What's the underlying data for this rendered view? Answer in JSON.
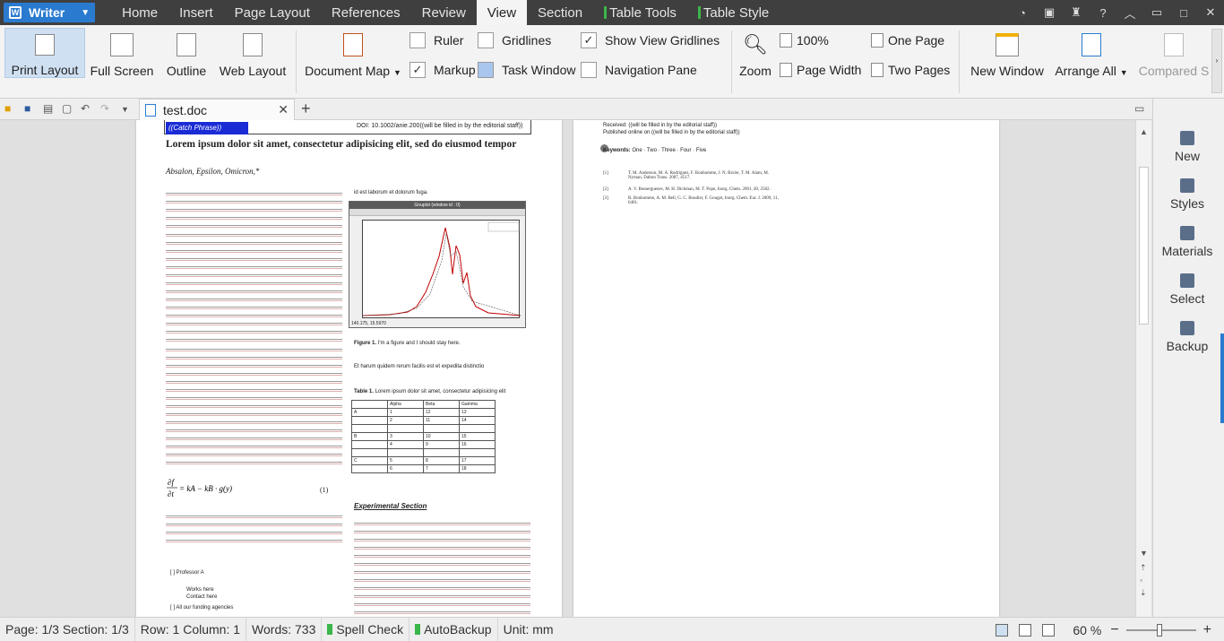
{
  "app": {
    "name": "Writer"
  },
  "menu": {
    "tabs": [
      {
        "label": "Home"
      },
      {
        "label": "Insert"
      },
      {
        "label": "Page Layout"
      },
      {
        "label": "References"
      },
      {
        "label": "Review"
      },
      {
        "label": "View"
      },
      {
        "label": "Section"
      },
      {
        "label": "Table Tools"
      },
      {
        "label": "Table Style"
      }
    ],
    "active": "View",
    "help": "?"
  },
  "ribbon": {
    "print_layout": "Print Layout",
    "full_screen": "Full Screen",
    "outline": "Outline",
    "web_layout": "Web Layout",
    "document_map": "Document Map",
    "ruler": "Ruler",
    "gridlines": "Gridlines",
    "show_view_gridlines": "Show View Gridlines",
    "markup": "Markup",
    "task_window": "Task Window",
    "navigation_pane": "Navigation Pane",
    "zoom": "Zoom",
    "zoom_100": "100%",
    "page_width": "Page Width",
    "one_page": "One Page",
    "two_pages": "Two Pages",
    "new_window": "New Window",
    "arrange_all": "Arrange All",
    "compared": "Compared S",
    "checks": {
      "ruler": false,
      "gridlines": false,
      "show_view_gridlines": true,
      "markup": true,
      "task_window": false,
      "navigation_pane": false
    }
  },
  "document_tab": {
    "title": "test.doc",
    "new_tab": "+"
  },
  "doc": {
    "catch_phrase": "((Catch Phrase))",
    "doi": "DOI: 10.1002/anie.200((will be filled in by the editorial staff))",
    "title": "Lorem ipsum dolor sit amet, consectetur adipisicing elit, sed do eiusmod tempor",
    "authors": "Absalon, Epsilon, Omicron,*",
    "col2_top": "id est laborum et dolorum fuga.",
    "figure_window_title": "Gnuplot (window id : 0)",
    "figure_coords": "140.175, 15.5970",
    "figure_caption_label": "Figure 1.",
    "figure_caption": "I'm a figure and I should stay here.",
    "et_harum": "Et harum quidem rerum facilis est et expedita distinctio",
    "table_caption_label": "Table 1.",
    "table_caption": "Lorem ipsum dolor sit amet, consectetur adipisicing elit",
    "table": {
      "headers": [
        "",
        "Alpha",
        "Beta",
        "Gamma"
      ],
      "rows": [
        [
          "A",
          "1",
          "12",
          "13"
        ],
        [
          "",
          "2",
          "11",
          "14"
        ],
        [
          "",
          "",
          "",
          ""
        ],
        [
          "B",
          "3",
          "10",
          "15"
        ],
        [
          "",
          "4",
          "9",
          "16"
        ],
        [
          "",
          "",
          "",
          ""
        ],
        [
          "C",
          "5",
          "8",
          "17"
        ],
        [
          "",
          "6",
          "7",
          "18"
        ]
      ]
    },
    "equation_number": "(1)",
    "experimental_section": "Experimental Section",
    "professor": "[  ]    Professor A",
    "works_here": "Works here",
    "contact_here": "Contact here",
    "funding": "[  ]  All our funding agencies",
    "received": "Received: ((will be filled in by the editorial staff))",
    "published": "Published online on ((will be filled in by the editorial staff))",
    "keywords_label": "Keywords:",
    "keywords": "One · Two · Three · Four · Five",
    "references": [
      {
        "num": "[1]",
        "text": "T. M. Anderson, M. A. Rodriguez, F. Bonhomme, J. N. Bixler, T. M. Alam, M. Nyman, Dalton Trans. 2007, 4517."
      },
      {
        "num": "[2]",
        "text": "A. V. Besserguenev, M. H. Dickman, M. T. Pope, Inorg. Chem. 2001, 40, 2582."
      },
      {
        "num": "[3]",
        "text": "R. Bonhomme, A. M. Bell, G. C. Boudier, F. Gouget, Inorg. Chem. Eur. J. 2009, 11, 6401."
      }
    ]
  },
  "taskpane": {
    "items": [
      {
        "label": "New"
      },
      {
        "label": "Styles"
      },
      {
        "label": "Materials"
      },
      {
        "label": "Select"
      },
      {
        "label": "Backup"
      }
    ]
  },
  "status": {
    "page": "Page: 1/3",
    "section": "Section: 1/3",
    "rowcol": "Row: 1  Column: 1",
    "words": "Words: 733",
    "spell": "Spell Check",
    "autobackup": "AutoBackup",
    "unit": "Unit: mm",
    "zoom": "60 %",
    "zoom_minus": "−",
    "zoom_plus": "+"
  },
  "colors": {
    "accent": "#2a7bd0",
    "menubar": "#3f3f3f",
    "green": "#3bb64a"
  }
}
